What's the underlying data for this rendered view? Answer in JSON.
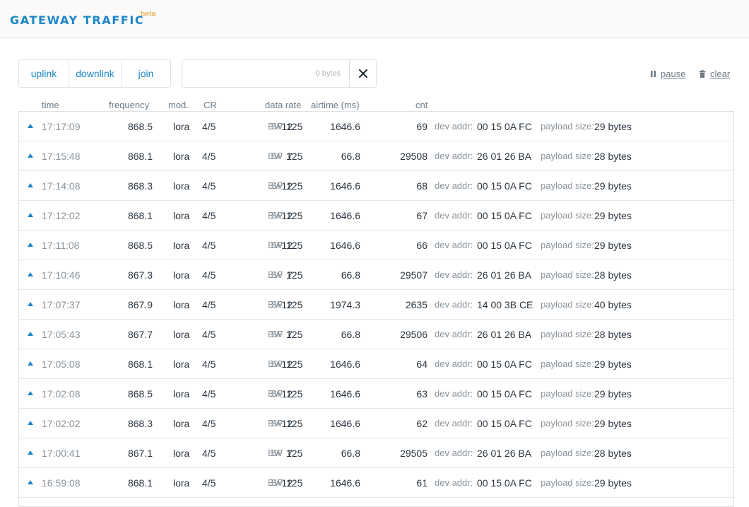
{
  "header": {
    "title": "GATEWAY TRAFFIC",
    "badge": "beta"
  },
  "filters": [
    {
      "label": "uplink"
    },
    {
      "label": "downlink"
    },
    {
      "label": "join"
    }
  ],
  "search": {
    "bytes": "0 bytes"
  },
  "controls": {
    "pause": "pause",
    "clear": "clear"
  },
  "columns": {
    "time": "time",
    "frequency": "frequency",
    "mod": "mod.",
    "cr": "CR",
    "data_rate": "data rate",
    "airtime": "airtime (ms)",
    "cnt": "cnt"
  },
  "row_labels": {
    "sf": "SF",
    "bw": "BW",
    "dev_addr": "dev addr:",
    "payload_size": "payload size:"
  },
  "rows": [
    {
      "time": "17:17:09",
      "frequency": "868.5",
      "mod": "lora",
      "cr": "4/5",
      "sf": "12",
      "bw": "125",
      "airtime": "1646.6",
      "cnt": "69",
      "dev_addr": "00 15 0A FC",
      "payload": "29 bytes"
    },
    {
      "time": "17:15:48",
      "frequency": "868.1",
      "mod": "lora",
      "cr": "4/5",
      "sf": "7",
      "bw": "125",
      "airtime": "66.8",
      "cnt": "29508",
      "dev_addr": "26 01 26 BA",
      "payload": "28 bytes"
    },
    {
      "time": "17:14:08",
      "frequency": "868.3",
      "mod": "lora",
      "cr": "4/5",
      "sf": "12",
      "bw": "125",
      "airtime": "1646.6",
      "cnt": "68",
      "dev_addr": "00 15 0A FC",
      "payload": "29 bytes"
    },
    {
      "time": "17:12:02",
      "frequency": "868.1",
      "mod": "lora",
      "cr": "4/5",
      "sf": "12",
      "bw": "125",
      "airtime": "1646.6",
      "cnt": "67",
      "dev_addr": "00 15 0A FC",
      "payload": "29 bytes"
    },
    {
      "time": "17:11:08",
      "frequency": "868.5",
      "mod": "lora",
      "cr": "4/5",
      "sf": "12",
      "bw": "125",
      "airtime": "1646.6",
      "cnt": "66",
      "dev_addr": "00 15 0A FC",
      "payload": "29 bytes"
    },
    {
      "time": "17:10:46",
      "frequency": "867.3",
      "mod": "lora",
      "cr": "4/5",
      "sf": "7",
      "bw": "125",
      "airtime": "66.8",
      "cnt": "29507",
      "dev_addr": "26 01 26 BA",
      "payload": "28 bytes"
    },
    {
      "time": "17:07:37",
      "frequency": "867.9",
      "mod": "lora",
      "cr": "4/5",
      "sf": "12",
      "bw": "125",
      "airtime": "1974.3",
      "cnt": "2635",
      "dev_addr": "14 00 3B CE",
      "payload": "40 bytes"
    },
    {
      "time": "17:05:43",
      "frequency": "867.7",
      "mod": "lora",
      "cr": "4/5",
      "sf": "7",
      "bw": "125",
      "airtime": "66.8",
      "cnt": "29506",
      "dev_addr": "26 01 26 BA",
      "payload": "28 bytes"
    },
    {
      "time": "17:05:08",
      "frequency": "868.1",
      "mod": "lora",
      "cr": "4/5",
      "sf": "12",
      "bw": "125",
      "airtime": "1646.6",
      "cnt": "64",
      "dev_addr": "00 15 0A FC",
      "payload": "29 bytes"
    },
    {
      "time": "17:02:08",
      "frequency": "868.5",
      "mod": "lora",
      "cr": "4/5",
      "sf": "12",
      "bw": "125",
      "airtime": "1646.6",
      "cnt": "63",
      "dev_addr": "00 15 0A FC",
      "payload": "29 bytes"
    },
    {
      "time": "17:02:02",
      "frequency": "868.3",
      "mod": "lora",
      "cr": "4/5",
      "sf": "12",
      "bw": "125",
      "airtime": "1646.6",
      "cnt": "62",
      "dev_addr": "00 15 0A FC",
      "payload": "29 bytes"
    },
    {
      "time": "17:00:41",
      "frequency": "867.1",
      "mod": "lora",
      "cr": "4/5",
      "sf": "7",
      "bw": "125",
      "airtime": "66.8",
      "cnt": "29505",
      "dev_addr": "26 01 26 BA",
      "payload": "28 bytes"
    },
    {
      "time": "16:59:08",
      "frequency": "868.1",
      "mod": "lora",
      "cr": "4/5",
      "sf": "12",
      "bw": "125",
      "airtime": "1646.6",
      "cnt": "61",
      "dev_addr": "00 15 0A FC",
      "payload": "29 bytes"
    }
  ],
  "colors": {
    "accent": "#1d86c8",
    "badge": "#e8a02e",
    "muted": "#8a949c"
  }
}
